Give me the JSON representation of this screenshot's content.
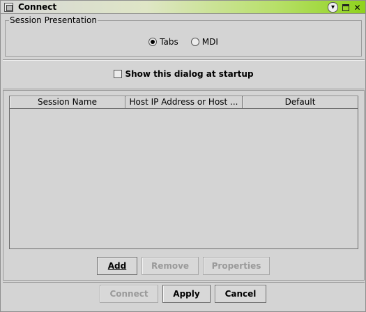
{
  "window": {
    "title": "Connect"
  },
  "session_presentation": {
    "legend": "Session Presentation",
    "options": [
      {
        "label": "Tabs",
        "selected": true
      },
      {
        "label": "MDI",
        "selected": false
      }
    ]
  },
  "startup": {
    "label": "Show this dialog at startup",
    "checked": false
  },
  "table": {
    "columns": [
      "Session Name",
      "Host IP Address or Host ...",
      "Default"
    ],
    "rows": []
  },
  "table_buttons": {
    "add": "Add",
    "remove": "Remove",
    "properties": "Properties"
  },
  "dialog_buttons": {
    "connect": "Connect",
    "apply": "Apply",
    "cancel": "Cancel"
  },
  "colors": {
    "titlebar_accent": "#8fd21d",
    "background": "#d4d4d4",
    "disabled_text": "#9a9a9a"
  }
}
